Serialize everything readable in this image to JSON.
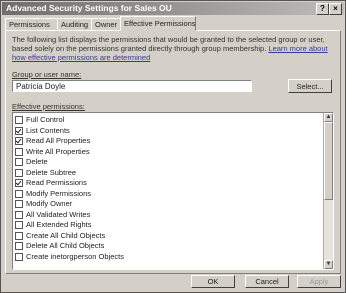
{
  "window": {
    "title": "Advanced Security Settings for Sales OU",
    "help_glyph": "?",
    "close_glyph": "×"
  },
  "tabs": [
    {
      "label": "Permissions"
    },
    {
      "label": "Auditing"
    },
    {
      "label": "Owner"
    },
    {
      "label": "Effective Permissions"
    }
  ],
  "effective": {
    "description": "The following list displays the permissions that would be granted to the selected group or user, based solely on the permissions granted directly through group membership.",
    "link_text": "Learn more about how effective permissions are determined",
    "group_label": "Group or user name:",
    "group_value": "Patricia Doyle",
    "select_button": "Select...",
    "perm_label": "Effective permissions:"
  },
  "permissions": [
    {
      "label": "Full Control",
      "checked": false
    },
    {
      "label": "List Contents",
      "checked": true
    },
    {
      "label": "Read All Properties",
      "checked": true
    },
    {
      "label": "Write All Properties",
      "checked": false
    },
    {
      "label": "Delete",
      "checked": false
    },
    {
      "label": "Delete Subtree",
      "checked": false
    },
    {
      "label": "Read Permissions",
      "checked": true
    },
    {
      "label": "Modify Permissions",
      "checked": false
    },
    {
      "label": "Modify Owner",
      "checked": false
    },
    {
      "label": "All Validated Writes",
      "checked": false
    },
    {
      "label": "All Extended Rights",
      "checked": false
    },
    {
      "label": "Create All Child Objects",
      "checked": false
    },
    {
      "label": "Delete All Child Objects",
      "checked": false
    },
    {
      "label": "Create inetorgperson Objects",
      "checked": false
    }
  ],
  "scrollbar": {
    "up_glyph": "▲",
    "down_glyph": "▼"
  },
  "buttons": {
    "ok": "OK",
    "cancel": "Cancel",
    "apply": "Apply"
  }
}
